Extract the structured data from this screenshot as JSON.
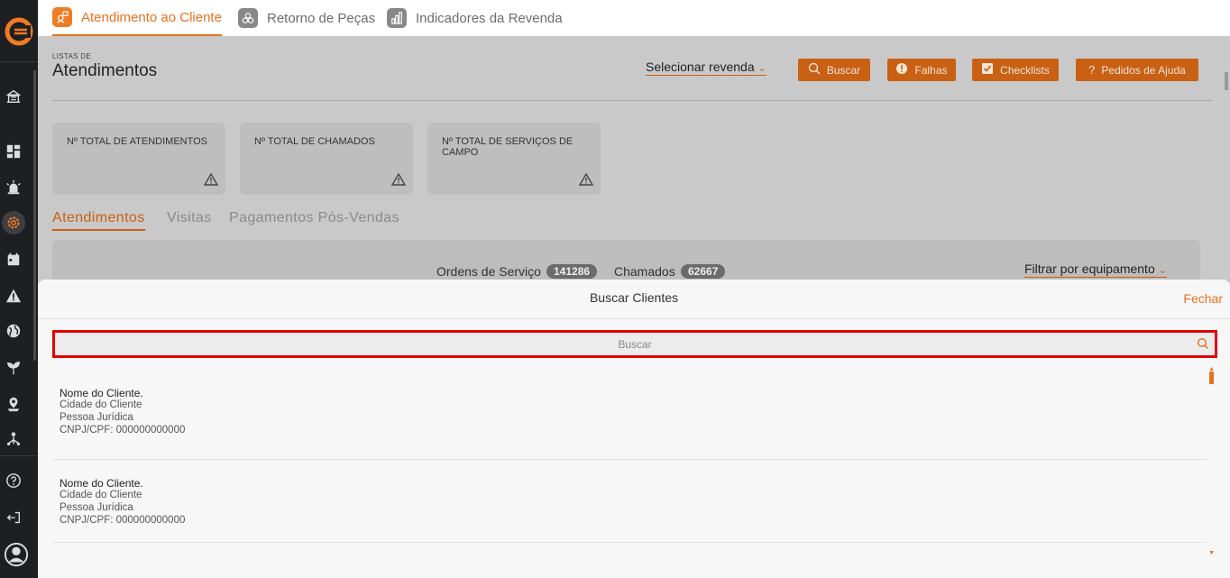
{
  "top_tabs": [
    {
      "label": "Atendimento ao Cliente",
      "active": true
    },
    {
      "label": "Retorno de Peças",
      "active": false
    },
    {
      "label": "Indicadores da Revenda",
      "active": false
    }
  ],
  "page": {
    "eyebrow": "LISTAS DE",
    "title": "Atendimentos",
    "select_revenda": "Selecionar revenda",
    "buttons": {
      "buscar": "Buscar",
      "falhas": "Falhas",
      "checklists": "Checklists",
      "pedidos": "Pedidos de Ajuda"
    },
    "cards": [
      {
        "title": "Nº TOTAL DE ATENDIMENTOS"
      },
      {
        "title": "Nº TOTAL DE CHAMADOS"
      },
      {
        "title": "Nº TOTAL DE SERVIÇOS DE CAMPO"
      }
    ],
    "subtabs": [
      "Atendimentos",
      "Visitas",
      "Pagamentos Pós-Vendas"
    ],
    "panel": {
      "ordens_label": "Ordens de Serviço",
      "ordens_count": "141286",
      "chamados_label": "Chamados",
      "chamados_count": "62667",
      "filtrar": "Filtrar por equipamento"
    }
  },
  "modal": {
    "title": "Buscar Clientes",
    "close": "Fechar",
    "search_placeholder": "Buscar",
    "clients": [
      {
        "name": "Nome do Cliente.",
        "city": "Cidade do Cliente",
        "type": "Pessoa Jurídica",
        "doc": "CNPJ/CPF: 000000000000"
      },
      {
        "name": "Nome do Cliente.",
        "city": "Cidade do Cliente",
        "type": "Pessoa Jurídica",
        "doc": "CNPJ/CPF: 000000000000"
      }
    ]
  },
  "colors": {
    "accent": "#e8711e",
    "accent_dark": "#c96013",
    "sidebar_bg": "#1e1f21",
    "highlight": "#e30000"
  }
}
